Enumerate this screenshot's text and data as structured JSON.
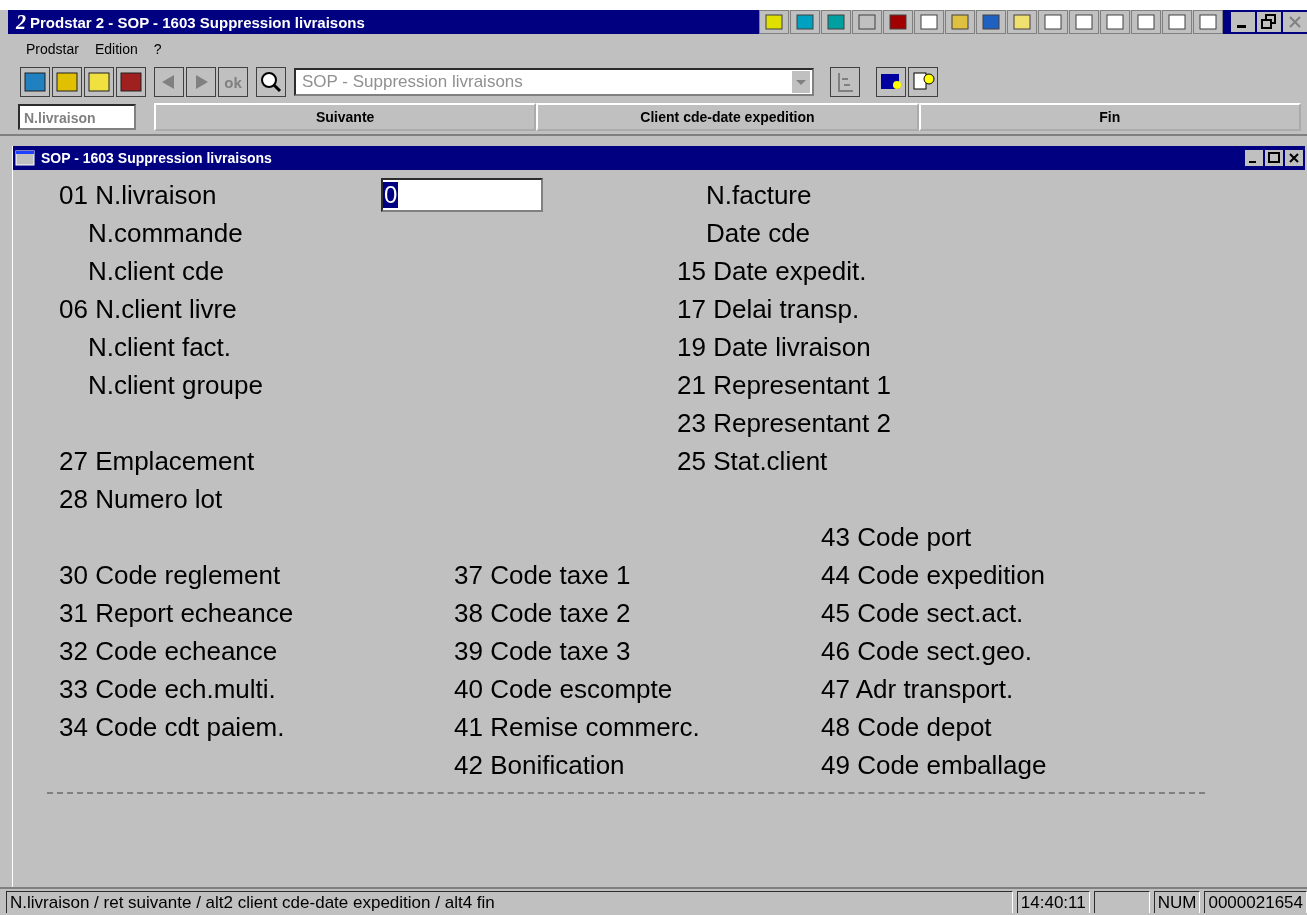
{
  "window": {
    "title": "Prodstar 2 - SOP - 1603 Suppression livraisons",
    "logo": "2"
  },
  "menu": [
    "Prodstar",
    "Edition",
    "?"
  ],
  "toolbar": {
    "ok_label": "ok",
    "combo": {
      "value": "SOP - Suppression livraisons",
      "disabled": true
    }
  },
  "function_bar": {
    "field": "N.livraison",
    "keys": [
      "Suivante",
      "Client cde-date expedition",
      "Fin"
    ]
  },
  "child_window": {
    "title": "SOP - 1603 Suppression livraisons"
  },
  "top_left": [
    [
      {
        "label": "01 N.livraison",
        "kind": "numbered",
        "value": "0"
      },
      {
        "label": "N.commande",
        "kind": "plain"
      },
      {
        "label": "N.client cde",
        "kind": "plain"
      },
      {
        "label": "06 N.client livre",
        "kind": "numbered"
      },
      {
        "label": "N.client fact.",
        "kind": "plain"
      },
      {
        "label": "N.client groupe",
        "kind": "plain"
      }
    ],
    [
      {
        "label": "27 Emplacement",
        "kind": "numbered"
      },
      {
        "label": "28 Numero lot",
        "kind": "numbered"
      }
    ]
  ],
  "top_right": [
    {
      "label": "N.facture",
      "kind": "plain"
    },
    {
      "label": "Date cde",
      "kind": "plain"
    },
    {
      "label": "15 Date expedit.",
      "kind": "numbered"
    },
    {
      "label": "17 Delai transp.",
      "kind": "numbered"
    },
    {
      "label": "19 Date livraison",
      "kind": "numbered"
    },
    {
      "label": "21 Representant 1",
      "kind": "numbered"
    },
    {
      "label": "23 Representant 2",
      "kind": "numbered"
    },
    {
      "label": "25 Stat.client",
      "kind": "numbered"
    }
  ],
  "bottom_lead": {
    "label": "43 Code port"
  },
  "bottom_columns": [
    [
      {
        "label": "30 Code reglement"
      },
      {
        "label": "31 Report echeance"
      },
      {
        "label": "32 Code echeance"
      },
      {
        "label": "33 Code ech.multi."
      },
      {
        "label": "34 Code cdt paiem."
      }
    ],
    [
      {
        "label": "37 Code taxe 1"
      },
      {
        "label": "38 Code taxe 2"
      },
      {
        "label": "39 Code taxe 3"
      },
      {
        "label": "40 Code escompte"
      },
      {
        "label": "41 Remise commerc."
      },
      {
        "label": "42 Bonification"
      }
    ],
    [
      {
        "label": "44 Code expedition"
      },
      {
        "label": "45 Code sect.act."
      },
      {
        "label": "46 Code sect.geo."
      },
      {
        "label": "47 Adr transport."
      },
      {
        "label": "48 Code depot"
      },
      {
        "label": "49 Code emballage"
      }
    ]
  ],
  "status_bar": {
    "message": "N.livraison / ret suivante / alt2 client cde-date expedition / alt4 fin",
    "time": "14:40:11",
    "mode": "NUM",
    "counter": "0000021654"
  }
}
